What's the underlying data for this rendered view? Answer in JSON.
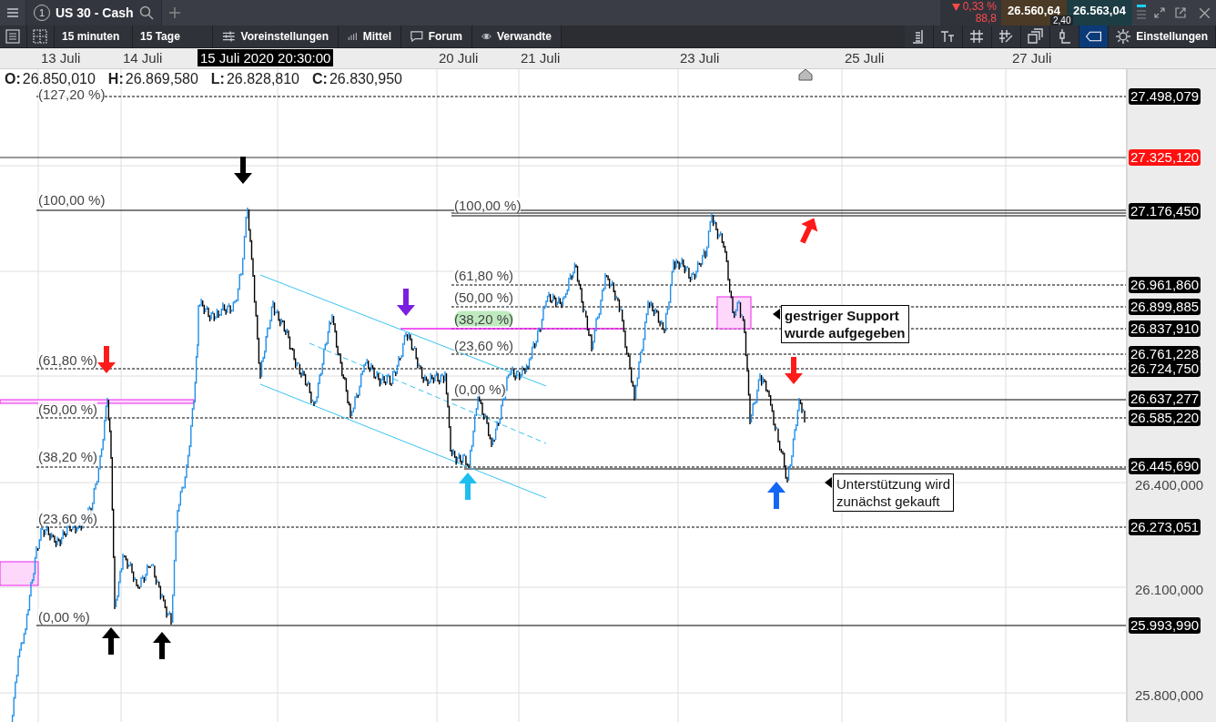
{
  "top_bar": {
    "tab": {
      "number": "1",
      "title": "US 30 - Cash"
    },
    "quote": {
      "change": "0,33 %",
      "points": "88,8",
      "bid": "26.560,64",
      "ask": "26.563,04",
      "spread": "2,40"
    }
  },
  "toolbar": {
    "interval": "15 minuten",
    "range": "15 Tage",
    "buttons": [
      {
        "kind": "presets",
        "label": "Voreinstellungen"
      },
      {
        "kind": "indicators",
        "label": "Mittel"
      },
      {
        "kind": "forum",
        "label": "Forum"
      },
      {
        "kind": "related",
        "label": "Verwandte"
      }
    ],
    "tools": [
      {
        "kind": "list",
        "selected": false
      },
      {
        "kind": "text",
        "selected": false
      },
      {
        "kind": "grid",
        "selected": false
      },
      {
        "kind": "draw",
        "selected": false
      },
      {
        "kind": "windows",
        "selected": false
      },
      {
        "kind": "candle",
        "selected": false
      },
      {
        "kind": "tag",
        "selected": true
      }
    ],
    "settings": "Einstellungen"
  },
  "date_axis": {
    "labels": [
      "13 Juli",
      "14 Juli",
      "20 Juli",
      "21 Juli",
      "23 Juli",
      "25 Juli",
      "27 Juli"
    ],
    "crosshair": "15 Juli 2020 20:30:00"
  },
  "ohlc": [
    {
      "key": "O:",
      "value": "26.850,010"
    },
    {
      "key": "H:",
      "value": "26.869,580"
    },
    {
      "key": "L:",
      "value": "26.828,810"
    },
    {
      "key": "C:",
      "value": "26.830,950"
    }
  ],
  "fib_left": [
    {
      "label": "(127,20 %)"
    },
    {
      "label": "(100,00 %)"
    },
    {
      "label": "(61,80 %)"
    },
    {
      "label": "(50,00 %)"
    },
    {
      "label": "(38,20 %)"
    },
    {
      "label": "(23,60 %)"
    },
    {
      "label": "(0,00 %)"
    }
  ],
  "fib_right": [
    {
      "label": "(100,00 %)",
      "highlighted": false
    },
    {
      "label": "(61,80 %)",
      "highlighted": false
    },
    {
      "label": "(50,00 %)",
      "highlighted": false
    },
    {
      "label": "(38,20 %)",
      "highlighted": true
    },
    {
      "label": "(23,60 %)",
      "highlighted": false
    },
    {
      "label": "(0,00 %)",
      "highlighted": false
    }
  ],
  "notes": [
    {
      "lines": [
        "gestriger Support",
        "wurde aufgegeben"
      ],
      "bold": true
    },
    {
      "lines": [
        "Unterstützung wird",
        "zunächst gekauft"
      ],
      "bold": false
    }
  ],
  "arrows": [
    {
      "kind": "down",
      "color": "#000000"
    },
    {
      "kind": "down",
      "color": "#ff1a1a"
    },
    {
      "kind": "down",
      "color": "#7a1fe0"
    },
    {
      "kind": "up",
      "color": "#1ebff0"
    },
    {
      "kind": "up",
      "color": "#ff1a1a"
    },
    {
      "kind": "down",
      "color": "#ff1a1a"
    },
    {
      "kind": "up",
      "color": "#1466f5"
    },
    {
      "kind": "up",
      "color": "#000000"
    },
    {
      "kind": "up",
      "color": "#000000"
    }
  ],
  "price_axis": {
    "ticks": [
      "26.400,000",
      "26.100,000",
      "25.800,000"
    ],
    "markers": [
      {
        "text": "27.498,079",
        "kind": "level"
      },
      {
        "text": "27.325,120",
        "kind": "alert"
      },
      {
        "text": "27.176,450",
        "kind": "level"
      },
      {
        "text": "26.961,860",
        "kind": "level"
      },
      {
        "text": "26.899,885",
        "kind": "level"
      },
      {
        "text": "26.837,910",
        "kind": "level"
      },
      {
        "text": "26.761,228",
        "kind": "level"
      },
      {
        "text": "26.724,750",
        "kind": "level"
      },
      {
        "text": "26.637,277",
        "kind": "level"
      },
      {
        "text": "26.585,220",
        "kind": "level"
      },
      {
        "text": "26.445,690",
        "kind": "level"
      },
      {
        "text": "26.273,051",
        "kind": "level"
      },
      {
        "text": "25.993,990",
        "kind": "level"
      }
    ]
  }
}
